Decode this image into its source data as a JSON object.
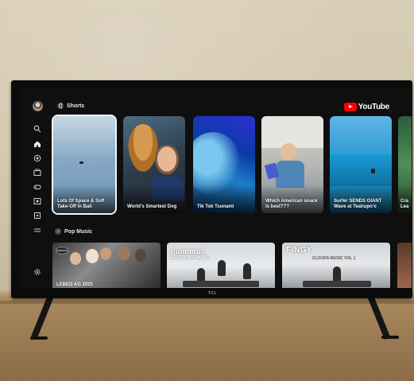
{
  "app": {
    "name": "YouTube",
    "brand_color": "#ff0000"
  },
  "tv_brand": "TCL",
  "sidebar": {
    "items": [
      {
        "icon": "account-avatar"
      },
      {
        "icon": "search-icon"
      },
      {
        "icon": "home-icon"
      },
      {
        "icon": "shorts-icon"
      },
      {
        "icon": "subscriptions-icon"
      },
      {
        "icon": "gaming-icon"
      },
      {
        "icon": "music-icon"
      },
      {
        "icon": "library-icon"
      },
      {
        "icon": "menu-icon"
      },
      {
        "icon": "settings-icon"
      }
    ]
  },
  "shorts": {
    "heading": "Shorts",
    "items": [
      {
        "title": "Lots Of Space & Soft Take-Off In Bali",
        "focused": true
      },
      {
        "title": "World's Smartest Dog"
      },
      {
        "title": "Tik Tok Tsunami"
      },
      {
        "title": "Which American snack is best???"
      },
      {
        "title": "Surfer SENDS GIANT Wave at Teahupo'o"
      },
      {
        "title": "Cra Lea"
      }
    ]
  },
  "pop_music": {
    "heading": "Pop Music",
    "items": [
      {
        "label": "LEBED AG 2025",
        "badge": "FRIENDS"
      },
      {
        "label": "gum.mp3",
        "sub": "RECORDING MUSIC"
      },
      {
        "label": "FINGY",
        "sub": "CLOUDS MUSIC VOL 1"
      },
      {
        "label": ""
      }
    ]
  }
}
